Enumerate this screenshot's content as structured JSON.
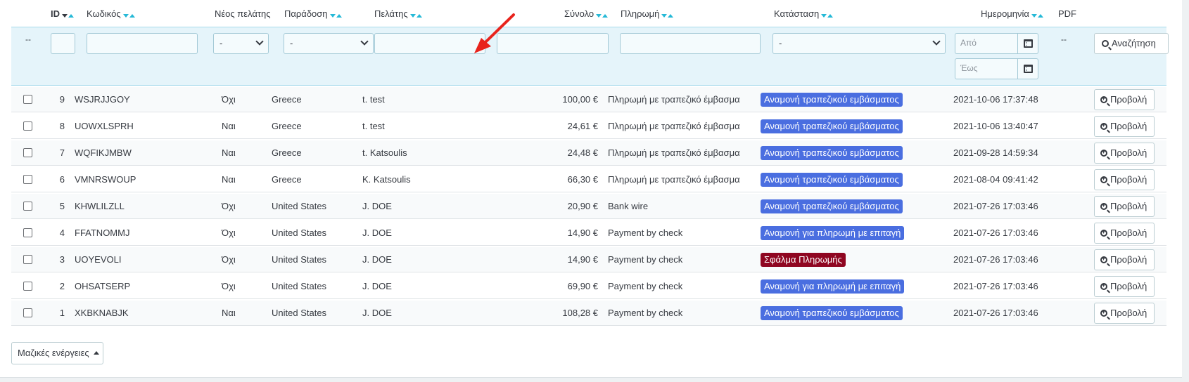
{
  "headers": {
    "id": "ID",
    "code": "Κωδικός",
    "new_customer": "Νέος πελάτης",
    "delivery": "Παράδοση",
    "customer": "Πελάτης",
    "total": "Σύνολο",
    "payment": "Πληρωμή",
    "status": "Κατάσταση",
    "date": "Ημερομηνία",
    "pdf": "PDF"
  },
  "filters": {
    "checkbox_placeholder": "--",
    "new_customer_selected": "-",
    "delivery_selected": "-",
    "status_selected": "-",
    "date_from_placeholder": "Από",
    "date_to_placeholder": "Έως",
    "pdf_placeholder": "--",
    "search_button": "Αναζήτηση"
  },
  "status_colors": {
    "awaiting": "#4a6ee0",
    "error": "#8f0621"
  },
  "orders": [
    {
      "id": "9",
      "code": "WSJRJJGOY",
      "new": "Όχι",
      "delivery": "Greece",
      "customer": "t. test",
      "total": "100,00 €",
      "payment": "Πληρωμή με τραπεζικό έμβασμα",
      "status": "Αναμονή τραπεζικού εμβάσματος",
      "status_type": "awaiting",
      "date": "2021-10-06 17:37:48",
      "action": "Προβολή"
    },
    {
      "id": "8",
      "code": "UOWXLSPRH",
      "new": "Ναι",
      "delivery": "Greece",
      "customer": "t. test",
      "total": "24,61 €",
      "payment": "Πληρωμή με τραπεζικό έμβασμα",
      "status": "Αναμονή τραπεζικού εμβάσματος",
      "status_type": "awaiting",
      "date": "2021-10-06 13:40:47",
      "action": "Προβολή"
    },
    {
      "id": "7",
      "code": "WQFIKJMBW",
      "new": "Ναι",
      "delivery": "Greece",
      "customer": "t. Katsoulis",
      "total": "24,48 €",
      "payment": "Πληρωμή με τραπεζικό έμβασμα",
      "status": "Αναμονή τραπεζικού εμβάσματος",
      "status_type": "awaiting",
      "date": "2021-09-28 14:59:34",
      "action": "Προβολή"
    },
    {
      "id": "6",
      "code": "VMNRSWOUP",
      "new": "Ναι",
      "delivery": "Greece",
      "customer": "K. Katsoulis",
      "total": "66,30 €",
      "payment": "Πληρωμή με τραπεζικό έμβασμα",
      "status": "Αναμονή τραπεζικού εμβάσματος",
      "status_type": "awaiting",
      "date": "2021-08-04 09:41:42",
      "action": "Προβολή"
    },
    {
      "id": "5",
      "code": "KHWLILZLL",
      "new": "Όχι",
      "delivery": "United States",
      "customer": "J. DOE",
      "total": "20,90 €",
      "payment": "Bank wire",
      "status": "Αναμονή τραπεζικού εμβάσματος",
      "status_type": "awaiting",
      "date": "2021-07-26 17:03:46",
      "action": "Προβολή"
    },
    {
      "id": "4",
      "code": "FFATNOMMJ",
      "new": "Όχι",
      "delivery": "United States",
      "customer": "J. DOE",
      "total": "14,90 €",
      "payment": "Payment by check",
      "status": "Αναμονή για πληρωμή με επιταγή",
      "status_type": "awaiting",
      "date": "2021-07-26 17:03:46",
      "action": "Προβολή"
    },
    {
      "id": "3",
      "code": "UOYEVOLI",
      "new": "Όχι",
      "delivery": "United States",
      "customer": "J. DOE",
      "total": "14,90 €",
      "payment": "Payment by check",
      "status": "Σφάλμα Πληρωμής",
      "status_type": "error",
      "date": "2021-07-26 17:03:46",
      "action": "Προβολή"
    },
    {
      "id": "2",
      "code": "OHSATSERP",
      "new": "Όχι",
      "delivery": "United States",
      "customer": "J. DOE",
      "total": "69,90 €",
      "payment": "Payment by check",
      "status": "Αναμονή για πληρωμή με επιταγή",
      "status_type": "awaiting",
      "date": "2021-07-26 17:03:46",
      "action": "Προβολή"
    },
    {
      "id": "1",
      "code": "XKBKNABJK",
      "new": "Ναι",
      "delivery": "United States",
      "customer": "J. DOE",
      "total": "108,28 €",
      "payment": "Payment by check",
      "status": "Αναμονή τραπεζικού εμβάσματος",
      "status_type": "awaiting",
      "date": "2021-07-26 17:03:46",
      "action": "Προβολή"
    }
  ],
  "bulk_actions": "Μαζικές ενέργειες"
}
